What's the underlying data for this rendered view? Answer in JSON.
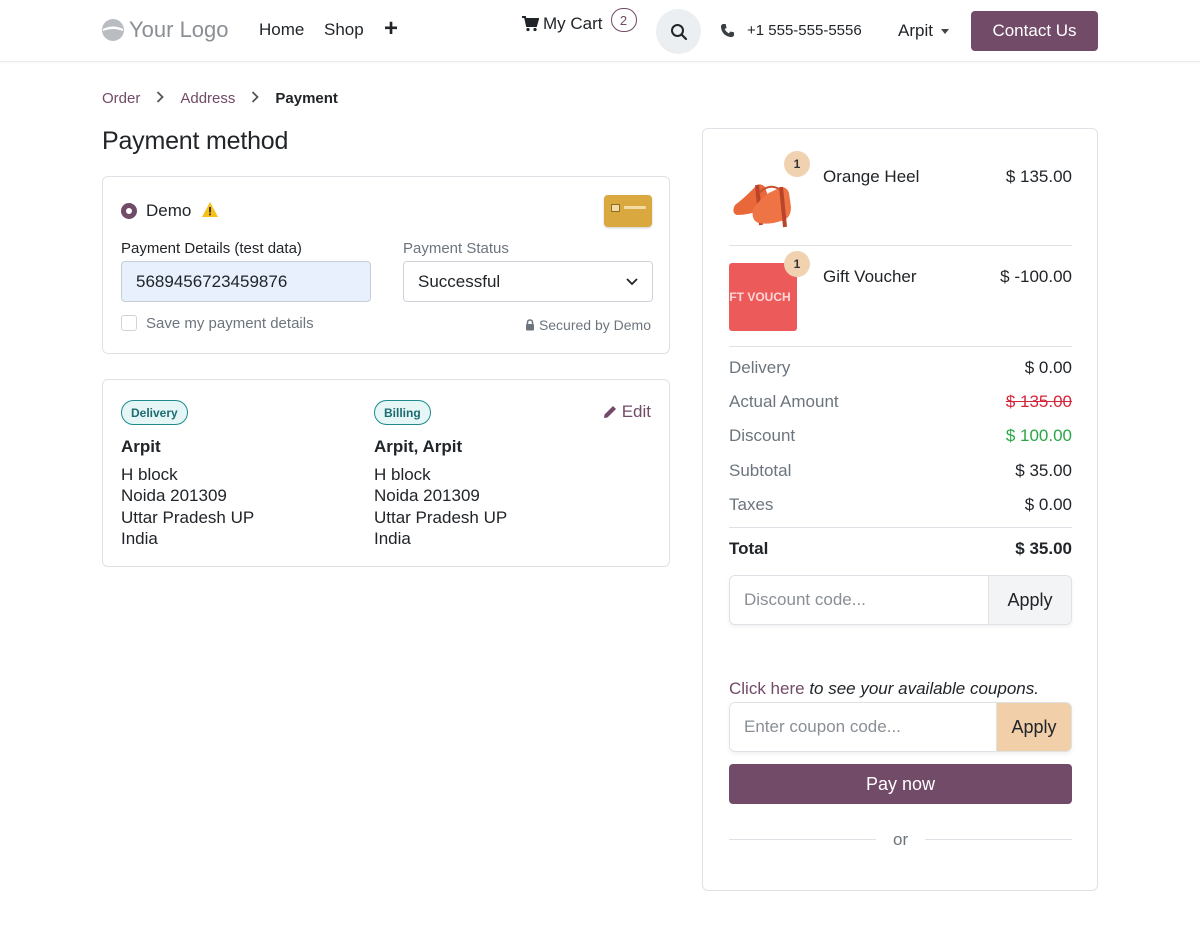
{
  "header": {
    "logo_text": "Your Logo",
    "nav": {
      "home": "Home",
      "shop": "Shop",
      "plus": "+"
    },
    "cart_label": "My Cart",
    "cart_count": "2",
    "phone": "+1 555-555-5556",
    "user": "Arpit",
    "contact_label": "Contact Us"
  },
  "breadcrumb": {
    "order": "Order",
    "address": "Address",
    "payment": "Payment",
    "sep": ">"
  },
  "page_title": "Payment method",
  "payment": {
    "method_label": "Demo",
    "details_label": "Payment Details (test data)",
    "card_number": "5689456723459876",
    "status_label": "Payment Status",
    "status_value": "Successful",
    "save_label": "Save my payment details",
    "secured_label": "Secured by Demo"
  },
  "address": {
    "delivery_badge": "Delivery",
    "billing_badge": "Billing",
    "edit_label": "Edit",
    "delivery": {
      "name": "Arpit",
      "line1": "H block",
      "line2": "Noida 201309",
      "line3": "Uttar Pradesh UP",
      "line4": "India"
    },
    "billing": {
      "name": "Arpit, Arpit",
      "line1": "H block",
      "line2": "Noida 201309",
      "line3": "Uttar Pradesh UP",
      "line4": "India"
    }
  },
  "summary": {
    "items": [
      {
        "name": "Orange Heel",
        "price": "$ 135.00",
        "qty": "1"
      },
      {
        "name": "Gift Voucher",
        "price": "$ -100.00",
        "qty": "1",
        "image_text": "FT VOUCH"
      }
    ],
    "delivery": {
      "label": "Delivery",
      "value": "$ 0.00"
    },
    "actual": {
      "label": "Actual Amount",
      "value": "$ 135.00"
    },
    "discount": {
      "label": "Discount",
      "value": "$ 100.00"
    },
    "subtotal": {
      "label": "Subtotal",
      "value": "$ 35.00"
    },
    "taxes": {
      "label": "Taxes",
      "value": "$ 0.00"
    },
    "total": {
      "label": "Total",
      "value": "$ 35.00"
    },
    "discount_placeholder": "Discount code...",
    "apply_label": "Apply",
    "coupon_link": "Click here",
    "coupon_text": " to see your available coupons.",
    "coupon_placeholder": "Enter coupon code...",
    "coupon_apply_label": "Apply",
    "pay_label": "Pay now",
    "or_label": "or"
  },
  "colors": {
    "brand": "#714b67",
    "accent_peach": "#f0cfa9",
    "danger": "#d6263c",
    "success": "#28a745"
  }
}
